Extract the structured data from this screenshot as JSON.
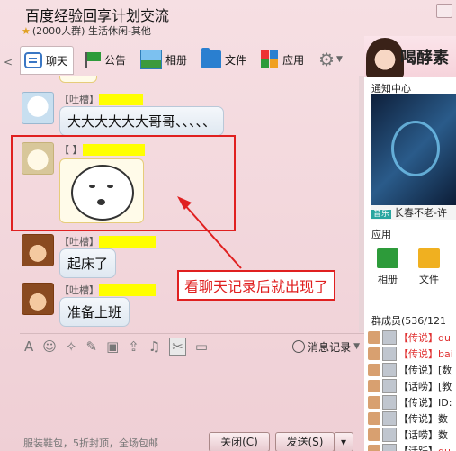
{
  "window": {
    "title": "百度经验回享计划交流",
    "subtitle": "(2000人群) 生活休闲-其他",
    "back_label": "<"
  },
  "tabs": [
    {
      "label": "聊天",
      "icon": "chat-icon"
    },
    {
      "label": "公告",
      "icon": "flag-icon"
    },
    {
      "label": "相册",
      "icon": "photo-icon"
    },
    {
      "label": "文件",
      "icon": "folder-icon"
    },
    {
      "label": "应用",
      "icon": "apps-icon"
    }
  ],
  "messages": [
    {
      "nick": "【吐槽】",
      "text": "大大大大大大哥哥、、、、、"
    },
    {
      "nick": "【 】",
      "sticker": "face-sticker"
    },
    {
      "nick": "【吐槽】",
      "text": "起床了"
    },
    {
      "nick": "【吐槽】",
      "text": "准备上班"
    }
  ],
  "annotation": "看聊天记录后就出现了",
  "input_toolbar": {
    "history_label": "消息记录"
  },
  "bottom": {
    "ad": "服装鞋包，5折封顶，全场包邮",
    "close_label": "关闭(C)",
    "send_label": "发送(S)"
  },
  "right_panel": {
    "brand": "喝酵素",
    "notice_title": "通知中心",
    "music_tag": "音乐",
    "music_text": "长春不老-许",
    "apps_title": "应用",
    "apps": [
      "相册",
      "文件"
    ],
    "members_title": "群成员(536/121"
  },
  "members": [
    {
      "tag": "【传说】",
      "name": "du"
    },
    {
      "tag": "【传说】",
      "name": "bai"
    },
    {
      "tag": "【传说】",
      "name": "[数"
    },
    {
      "tag": "【话唠】",
      "name": "[教"
    },
    {
      "tag": "【传说】",
      "name": "ID:"
    },
    {
      "tag": "【传说】",
      "name": "数"
    },
    {
      "tag": "【话唠】",
      "name": "数"
    },
    {
      "tag": "【活跃】",
      "name": "du"
    }
  ],
  "colors": {
    "accent_red": "#e02020",
    "highlight": "#ffff00",
    "window_bg": "#f0d4d8"
  }
}
